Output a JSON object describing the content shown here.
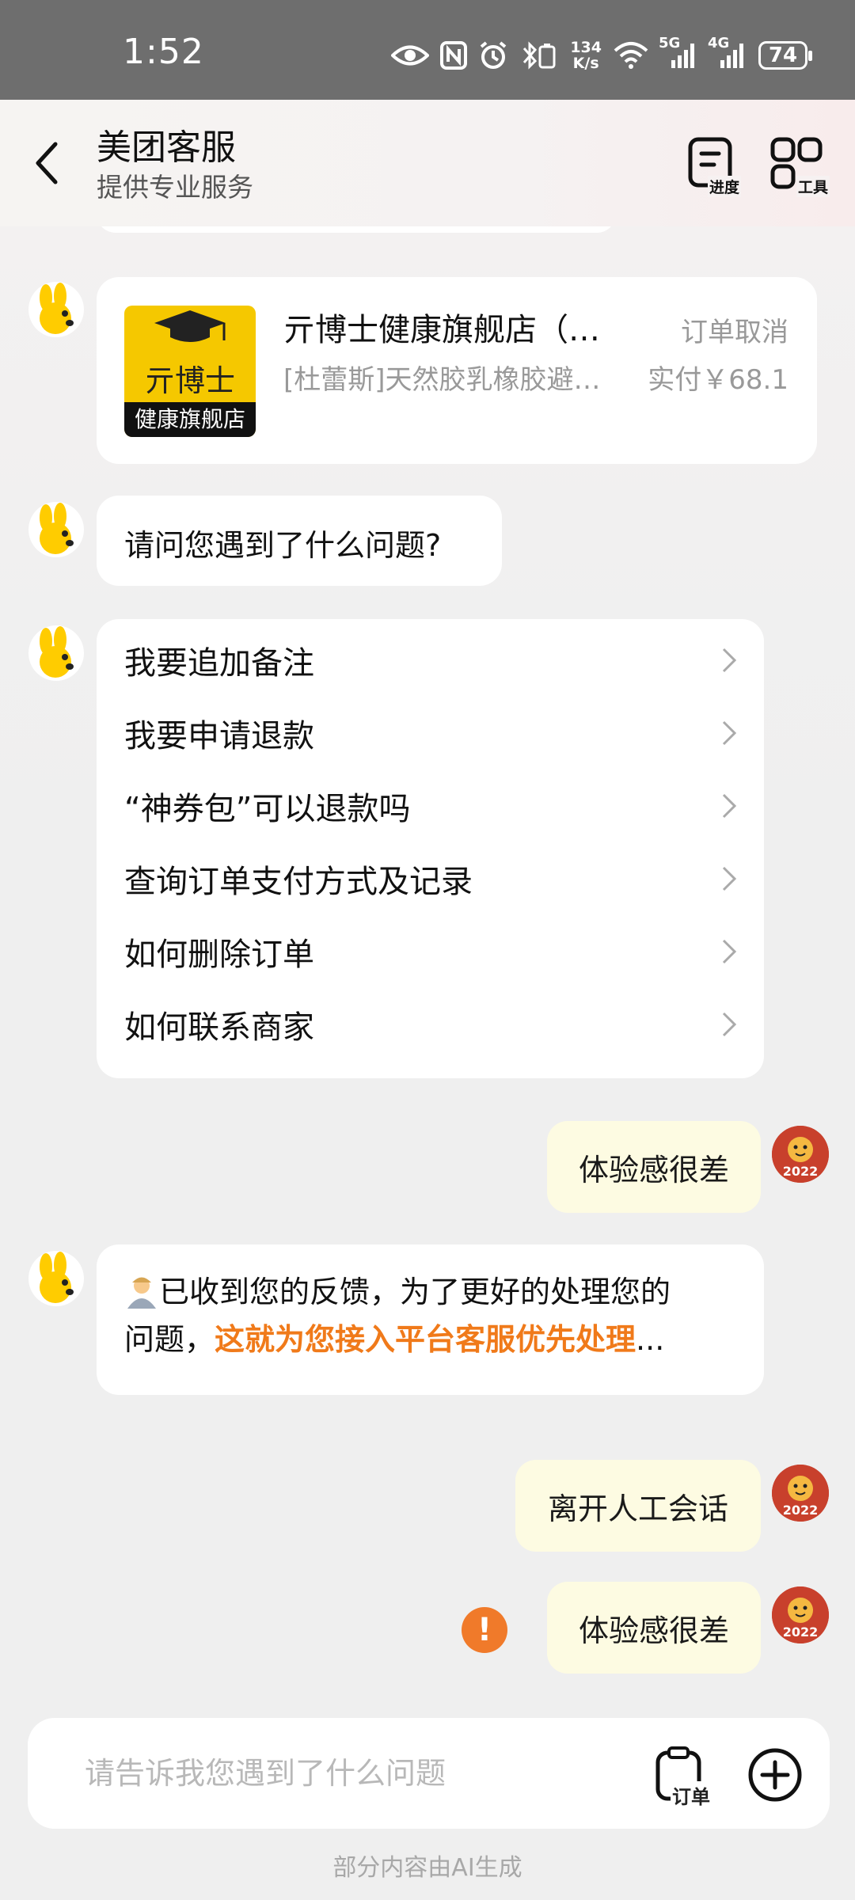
{
  "status_bar": {
    "time": "1:52",
    "speed_value": "134",
    "speed_unit": "K/s",
    "net1": "5G",
    "net2": "4G",
    "battery": "74"
  },
  "header": {
    "title": "美团客服",
    "subtitle": "提供专业服务",
    "progress_label": "进度",
    "tools_label": "工具"
  },
  "order_card": {
    "logo_text_top": "亓博士",
    "logo_text_bottom": "健康旗舰店",
    "shop_name": "亓博士健康旗舰店（…",
    "status": "订单取消",
    "product": "[杜蕾斯]天然胶乳橡胶避…",
    "paid": "实付￥68.1"
  },
  "messages": {
    "bot_question": "请问您遇到了什么问题?",
    "menu_items": [
      "我要追加备注",
      "我要申请退款",
      "“神券包”可以退款吗",
      "查询订单支付方式及记录",
      "如何删除订单",
      "如何联系商家"
    ],
    "user_msg_1": "体验感很差",
    "bot_reply_line1": "已收到您的反馈，为了更好的处理您的",
    "bot_reply_line2_prefix": "问题，",
    "bot_reply_highlight": "这就为您接入平台客服优先处理",
    "bot_reply_suffix": "...",
    "user_msg_2": "离开人工会话",
    "user_msg_3": "体验感很差",
    "user_avatar_year": "2022"
  },
  "input": {
    "placeholder": "请告诉我您遇到了什么问题",
    "order_label": "订单"
  },
  "footer_note": "部分内容由AI生成",
  "colors": {
    "highlight": "#f07a1a",
    "user_bubble": "#fdfbe2",
    "warn": "#f07a2a"
  }
}
